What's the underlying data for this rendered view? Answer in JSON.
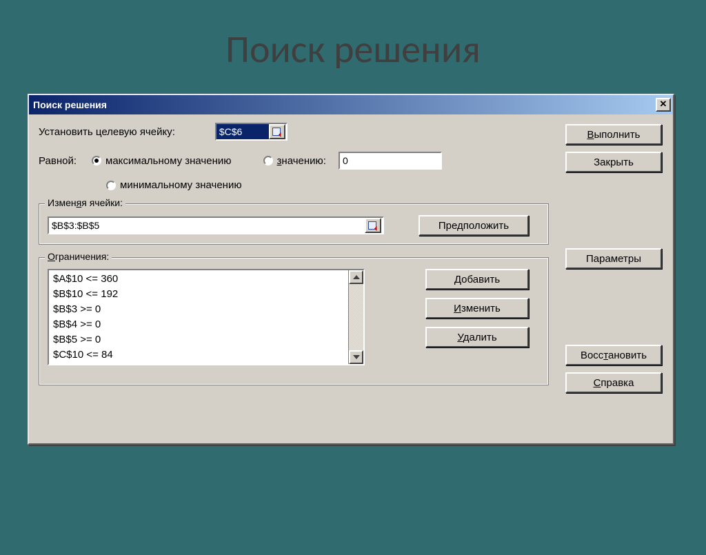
{
  "slide": {
    "title": "Поиск решения"
  },
  "dialog": {
    "title": "Поиск решения",
    "target_label": "Установить целевую ячейку:",
    "target_value": "$C$6",
    "equal_label": "Равной:",
    "radio_max": "максимальному значению",
    "radio_min": "минимальному значению",
    "radio_val": "значению:",
    "value_input": "0",
    "changing_legend": "Изменяя ячейки:",
    "changing_value": "$B$3:$B$5",
    "guess_btn": "Предположить",
    "constraints_legend": "Ограничения:",
    "constraints": [
      "$A$10 <= 360",
      "$B$10 <= 192",
      "$B$3 >= 0",
      "$B$4 >= 0",
      "$B$5 >= 0",
      "$C$10 <= 84"
    ],
    "add_btn": "Добавить",
    "change_btn": "Изменить",
    "delete_btn": "Удалить",
    "execute_btn": "Выполнить",
    "close_btn": "Закрыть",
    "params_btn": "Параметры",
    "reset_btn": "Восстановить",
    "help_btn": "Справка"
  }
}
